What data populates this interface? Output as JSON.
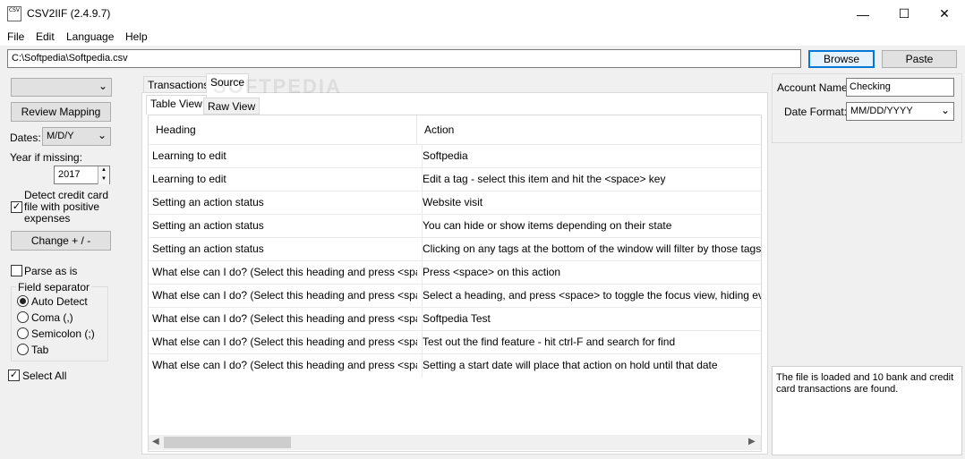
{
  "window": {
    "title": "CSV2IIF (2.4.9.7)",
    "icon_text": "CSV",
    "minimize": "—",
    "maximize": "☐",
    "close": "✕"
  },
  "menu": [
    "File",
    "Edit",
    "Language",
    "Help"
  ],
  "path": {
    "value": "C:\\Softpedia\\Softpedia.csv"
  },
  "buttons": {
    "browse": "Browse",
    "paste": "Paste",
    "review_mapping": "Review Mapping",
    "change": "Change + / -"
  },
  "left": {
    "mapping_value": "",
    "dates_label": "Dates:",
    "dates_value": "M/D/Y",
    "year_label": "Year if missing:",
    "year_value": "2017",
    "detect_label": "Detect credit card file with positive expenses",
    "detect_checked": true,
    "parse_label": "Parse as is",
    "field_separator_title": "Field separator",
    "separators": [
      {
        "label": "Auto Detect",
        "selected": true
      },
      {
        "label": "Coma (,)",
        "selected": false
      },
      {
        "label": "Semicolon (;)",
        "selected": false
      },
      {
        "label": "Tab",
        "selected": false
      }
    ],
    "select_all_label": "Select All",
    "select_all_checked": true
  },
  "tabs": {
    "outer": [
      "Transactions",
      "Source"
    ],
    "outer_active": "Source",
    "inner": [
      "Table View",
      "Raw View"
    ],
    "inner_active": "Table View"
  },
  "watermark": "SOFTPEDIA",
  "table": {
    "columns": [
      "Heading",
      "Action"
    ],
    "rows": [
      [
        "Learning to edit",
        "Softpedia"
      ],
      [
        "Learning to edit",
        "Edit a tag - select this item and hit the <space> key"
      ],
      [
        "Setting an action status",
        "Website visit"
      ],
      [
        "Setting an action status",
        "You can hide or show items depending on their state"
      ],
      [
        "Setting an action status",
        "Clicking on any tags at the bottom of the window will filter by those tags.  Note"
      ],
      [
        "What else can I do? (Select this heading and press <space>)",
        "Press <space> on this action"
      ],
      [
        "What else can I do? (Select this heading and press <space>)",
        "Select a heading, and press <space> to toggle the focus view, hiding everythi"
      ],
      [
        "What else can I do? (Select this heading and press <space>)",
        "Softpedia Test"
      ],
      [
        "What else can I do? (Select this heading and press <space>)",
        "Test out the find feature - hit ctrl-F and search for find"
      ],
      [
        "What else can I do? (Select this heading and press <space>)",
        "Setting a start date will place that action on hold until that date"
      ]
    ]
  },
  "right": {
    "account_label": "Account Name:",
    "account_value": "Checking",
    "date_format_label": "Date Format:",
    "date_format_value": "MM/DD/YYYY",
    "status": "The file is loaded and 10 bank and credit card transactions are found."
  }
}
